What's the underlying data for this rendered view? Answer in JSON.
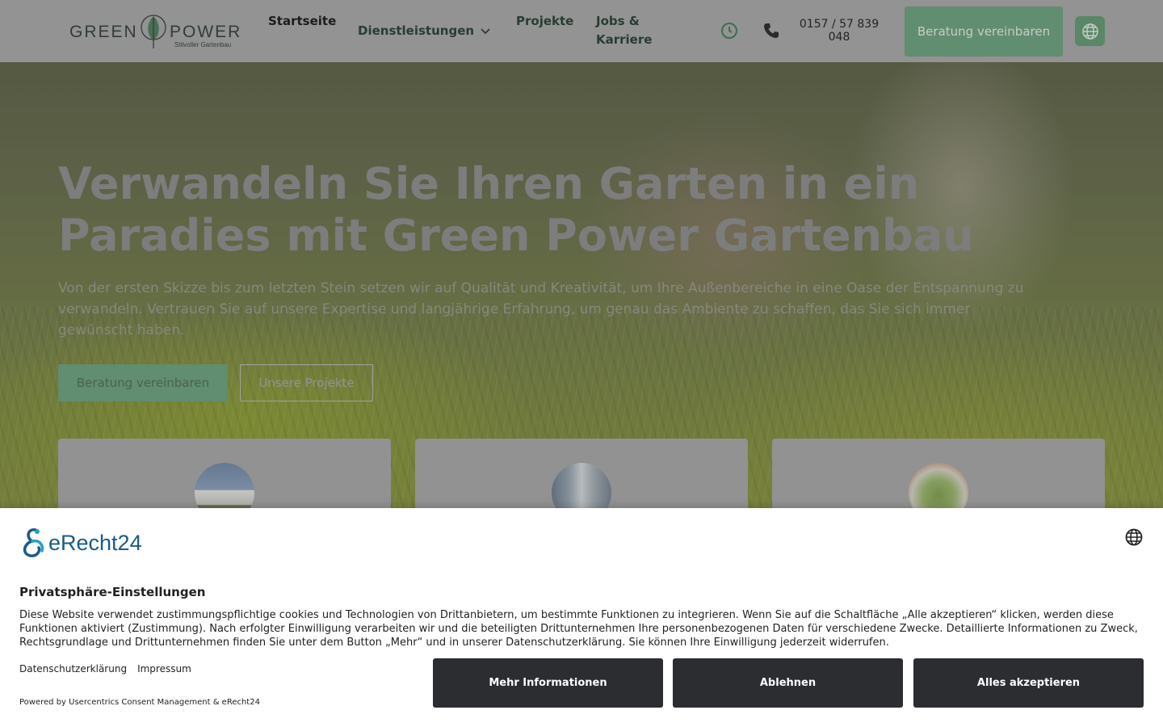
{
  "header": {
    "logo": {
      "word_left": "GREEN",
      "word_right": "POWER",
      "tagline": "Stilvoller Gartenbau"
    },
    "nav": {
      "start": "Startseite",
      "dienstleistungen": "Dienstleistungen",
      "projekte": "Projekte",
      "jobs": "Jobs & Karriere"
    },
    "phone": "0157 / 57 839 048",
    "cta": "Beratung vereinbaren",
    "icons": {
      "clock": "clock-icon",
      "phone": "phone-icon",
      "globe": "globe-icon",
      "dropdown": "chevron-down-icon"
    }
  },
  "hero": {
    "title": "Verwandeln Sie Ihren Garten in ein Paradies mit Green Power Gartenbau",
    "subtitle": "Von der ersten Skizze bis zum letzten Stein setzen wir auf Qualität und Kreativität, um Ihre Außenbereiche in eine Oase der Entspannung zu verwandeln. Vertrauen Sie auf unsere Expertise und langjährige Erfahrung, um genau das Ambiente zu schaffen, das Sie sich immer gewünscht haben.",
    "primary_button": "Beratung vereinbaren",
    "secondary_button": "Unsere Projekte"
  },
  "cards": [
    {
      "image": "house-photo"
    },
    {
      "image": "building-photo"
    },
    {
      "image": "garden-plan-photo"
    }
  ],
  "consent": {
    "brand": "eRecht24",
    "title": "Privatsphäre-Einstellungen",
    "body": "Diese Website verwendet zustimmungspflichtige cookies und Technologien von Drittanbietern, um bestimmte Funktionen zu integrieren. Wenn Sie auf die Schaltfläche „Alle akzeptieren“ klicken, werden diese Funktionen aktiviert (Zustimmung). Nach erfolgter Einwilligung verarbeiten wir und die beteiligten Drittunternehmen Ihre personenbezogenen Daten für verschiedene Zwecke. Detaillierte Informationen zu Zweck, Rechtsgrundlage und Drittunternehmen finden Sie unter dem Button „Mehr“ und in unserer Datenschutzerklärung. Sie können Ihre Einwilligung jederzeit widerrufen.",
    "link_privacy": "Datenschutzerklärung",
    "link_imprint": "Impressum",
    "powered_by": "Powered by Usercentrics Consent Management & eRecht24",
    "btn_more": "Mehr Informationen",
    "btn_decline": "Ablehnen",
    "btn_accept": "Alles akzeptieren",
    "colors": {
      "button_bg": "#2b2d31",
      "brand_blue": "#1a5a8a"
    }
  },
  "colors": {
    "accent_green": "#6aa27d",
    "header_bg": "#a9a9a9"
  }
}
